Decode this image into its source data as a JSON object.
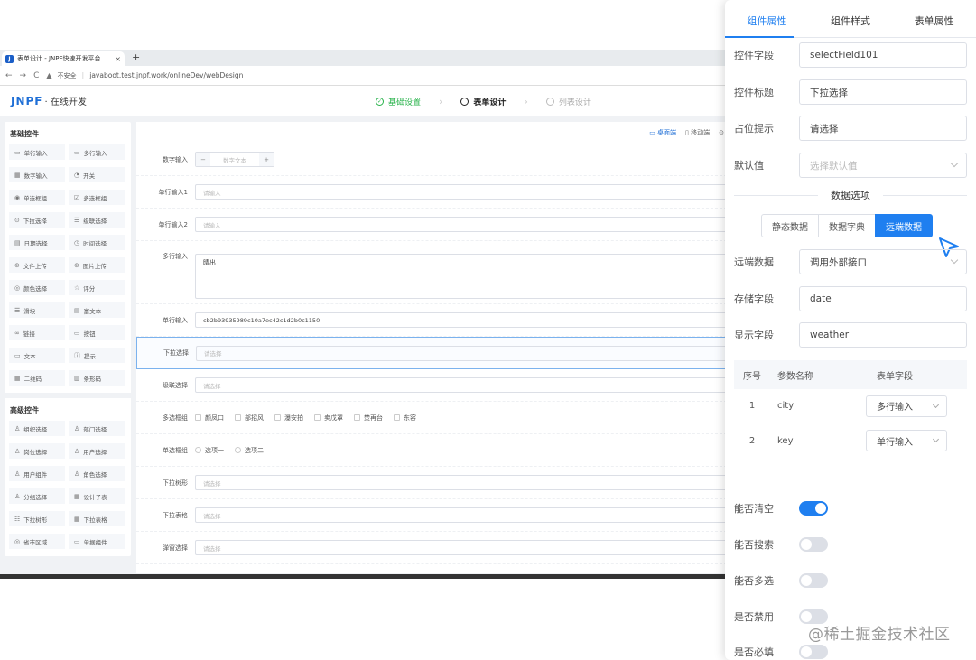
{
  "browser": {
    "tab_title": "表单设计 - JNPF快速开发平台",
    "tab_close": "×",
    "new_tab": "+",
    "nav_back": "←",
    "nav_forward": "→",
    "nav_reload": "C",
    "security_text": "不安全",
    "url": "javaboot.test.jnpf.work/onlineDev/webDesign"
  },
  "app": {
    "logo": "JNPF",
    "logo_suffix": "· 在线开发",
    "steps": [
      {
        "label": "基础设置",
        "state": "done"
      },
      {
        "label": "表单设计",
        "state": "active"
      },
      {
        "label": "列表设计",
        "state": "todo"
      }
    ]
  },
  "palette": {
    "basic_title": "基础控件",
    "basic": [
      {
        "icon": "input-icon",
        "glyph": "▭",
        "label": "单行输入"
      },
      {
        "icon": "textarea-icon",
        "glyph": "▭",
        "label": "多行输入"
      },
      {
        "icon": "number-icon",
        "glyph": "▦",
        "label": "数字输入"
      },
      {
        "icon": "switch-icon",
        "glyph": "◔",
        "label": "开关"
      },
      {
        "icon": "radio-icon",
        "glyph": "◉",
        "label": "单选框组"
      },
      {
        "icon": "checkbox-icon",
        "glyph": "☑",
        "label": "多选框组"
      },
      {
        "icon": "select-icon",
        "glyph": "⊙",
        "label": "下拉选择"
      },
      {
        "icon": "cascader-icon",
        "glyph": "☰",
        "label": "级联选择"
      },
      {
        "icon": "date-icon",
        "glyph": "▤",
        "label": "日期选择"
      },
      {
        "icon": "time-icon",
        "glyph": "◷",
        "label": "时间选择"
      },
      {
        "icon": "upload-file-icon",
        "glyph": "⊕",
        "label": "文件上传"
      },
      {
        "icon": "upload-image-icon",
        "glyph": "⊕",
        "label": "图片上传"
      },
      {
        "icon": "color-icon",
        "glyph": "◎",
        "label": "颜色选择"
      },
      {
        "icon": "rate-icon",
        "glyph": "☆",
        "label": "评分"
      },
      {
        "icon": "slider-icon",
        "glyph": "☰",
        "label": "滑块"
      },
      {
        "icon": "editor-icon",
        "glyph": "▤",
        "label": "富文本"
      },
      {
        "icon": "link-icon",
        "glyph": "∞",
        "label": "链接"
      },
      {
        "icon": "button-icon",
        "glyph": "▭",
        "label": "按钮"
      },
      {
        "icon": "text-icon",
        "glyph": "▭",
        "label": "文本"
      },
      {
        "icon": "alert-icon",
        "glyph": "ⓘ",
        "label": "提示"
      },
      {
        "icon": "qrcode-icon",
        "glyph": "▦",
        "label": "二维码"
      },
      {
        "icon": "barcode-icon",
        "glyph": "▥",
        "label": "条形码"
      }
    ],
    "advanced_title": "高级控件",
    "advanced": [
      {
        "icon": "org-icon",
        "glyph": "♙",
        "label": "组织选择"
      },
      {
        "icon": "dept-icon",
        "glyph": "♙",
        "label": "部门选择"
      },
      {
        "icon": "position-icon",
        "glyph": "♙",
        "label": "岗位选择"
      },
      {
        "icon": "user-icon",
        "glyph": "♙",
        "label": "用户选择"
      },
      {
        "icon": "user-comp-icon",
        "glyph": "♙",
        "label": "用户组件"
      },
      {
        "icon": "role-icon",
        "glyph": "♙",
        "label": "角色选择"
      },
      {
        "icon": "group-icon",
        "glyph": "♙",
        "label": "分组选择"
      },
      {
        "icon": "subtable-icon",
        "glyph": "▦",
        "label": "设计子表"
      },
      {
        "icon": "tree-icon",
        "glyph": "☷",
        "label": "下拉树形"
      },
      {
        "icon": "table-select-icon",
        "glyph": "▦",
        "label": "下拉表格"
      },
      {
        "icon": "area-icon",
        "glyph": "◎",
        "label": "省市区域"
      },
      {
        "icon": "single-comp-icon",
        "glyph": "▭",
        "label": "单据组件"
      }
    ]
  },
  "canvas": {
    "toolbar": [
      {
        "icon": "pc-icon",
        "label": "▭ 桌面端"
      },
      {
        "icon": "mobile-icon",
        "label": "▯ 移动端"
      },
      {
        "icon": "preview-icon",
        "label": "⊙"
      }
    ],
    "number_label": "数字输入",
    "number_minus": "−",
    "number_placeholder": "数字文本",
    "number_plus": "+",
    "rows": [
      {
        "label": "单行输入1",
        "value": "请输入",
        "filled": false
      },
      {
        "label": "单行输入2",
        "value": "请输入",
        "filled": false
      }
    ],
    "textarea_label": "多行输入",
    "textarea_value": "晴出",
    "id_label": "单行输入",
    "id_value": "cb2b93935989c10a7ec42c1d2b0c1150",
    "select_label": "下拉选择",
    "select_placeholder": "请选择",
    "cascader_label": "级联选择",
    "cascader_placeholder": "请选择",
    "checkbox_label": "多选框组",
    "checkboxes": [
      "颜凤口",
      "部招风",
      "瀑安拍",
      "卖戊罩",
      "焚再台",
      "东容"
    ],
    "radio_label": "单选框组",
    "radios": [
      "选项一",
      "选项二"
    ],
    "tree_label": "下拉树形",
    "tree_placeholder": "请选择",
    "table_label": "下拉表格",
    "table_placeholder": "请选择",
    "popup_label": "弹窗选择",
    "popup_placeholder": "请选择"
  },
  "panel": {
    "tabs": [
      "组件属性",
      "组件样式",
      "表单属性"
    ],
    "fields": [
      {
        "label": "控件字段",
        "value": "selectField101",
        "placeholder": false,
        "arrow": false
      },
      {
        "label": "控件标题",
        "value": "下拉选择",
        "placeholder": false,
        "arrow": false
      },
      {
        "label": "占位提示",
        "value": "请选择",
        "placeholder": false,
        "arrow": false
      },
      {
        "label": "默认值",
        "value": "选择默认值",
        "placeholder": true,
        "arrow": true
      }
    ],
    "divider_label": "数据选项",
    "data_source_buttons": [
      "静态数据",
      "数据字典",
      "远端数据"
    ],
    "data_source_active": "远端数据",
    "remote_fields": [
      {
        "label": "远端数据",
        "value": "调用外部接口",
        "arrow": true
      },
      {
        "label": "存储字段",
        "value": "date",
        "arrow": false
      },
      {
        "label": "显示字段",
        "value": "weather",
        "arrow": false
      }
    ],
    "param_table": {
      "headers": [
        "序号",
        "参数名称",
        "表单字段"
      ],
      "rows": [
        {
          "no": "1",
          "name": "city",
          "field": "多行输入"
        },
        {
          "no": "2",
          "name": "key",
          "field": "单行输入"
        }
      ]
    },
    "switches": [
      {
        "label": "能否清空",
        "on": true
      },
      {
        "label": "能否搜索",
        "on": false
      },
      {
        "label": "能否多选",
        "on": false
      },
      {
        "label": "是否禁用",
        "on": false
      },
      {
        "label": "是否必填",
        "on": false
      }
    ],
    "accent_color": "#1f7ff0"
  },
  "watermark": "@稀土掘金技术社区"
}
